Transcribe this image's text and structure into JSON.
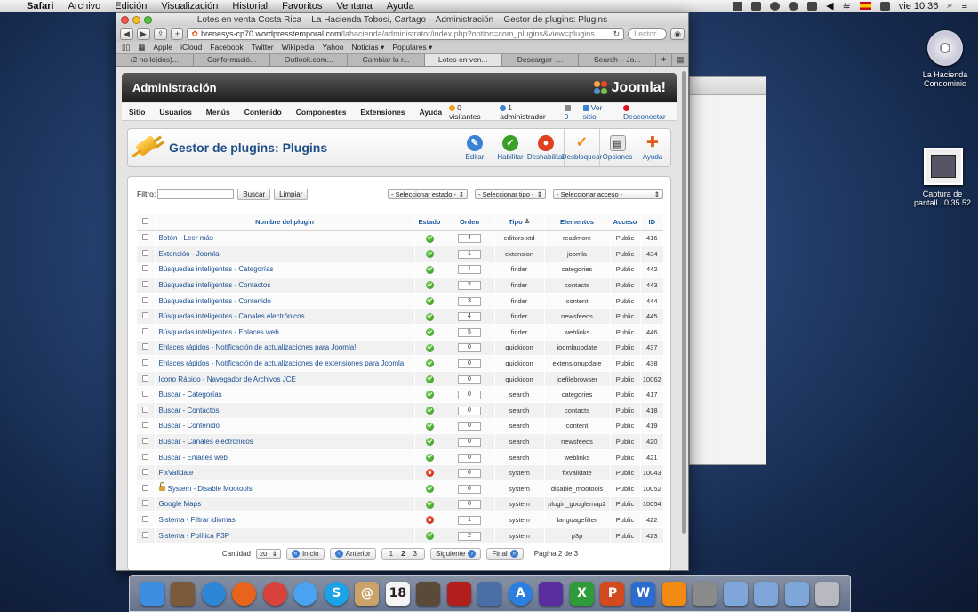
{
  "menubar": {
    "apple": "",
    "items": [
      "Safari",
      "Archivo",
      "Edición",
      "Visualización",
      "Historial",
      "Favoritos",
      "Ventana",
      "Ayuda"
    ],
    "clock": "vie 10:36"
  },
  "desktop": {
    "icons": [
      {
        "label": "La Hacienda Condominio"
      },
      {
        "label": "Captura de pantall...0.35.52"
      }
    ]
  },
  "browser": {
    "title": "Lotes en venta Costa Rica – La Hacienda Tobosi, Cartago – Administración – Gestor de plugins: Plugins",
    "url_main": "brenesys-cp70.wordpresstemporal.com",
    "url_path": "/lahacienda/administrator/index.php?option=com_plugins&view=plugins",
    "search_placeholder": "Lector",
    "bookmarks": [
      "Apple",
      "iCloud",
      "Facebook",
      "Twitter",
      "Wikipedia",
      "Yahoo",
      "Noticias ▾",
      "Populares ▾"
    ],
    "tabs": [
      "(2 no leídos)...",
      "Conformació...",
      "Outlook.com...",
      "Cambiar la r...",
      "Lotes en ven...",
      "Descargar -...",
      "Search – Jo..."
    ],
    "active_tab": 4
  },
  "joomla": {
    "header_title": "Administración",
    "logo_text": "Joomla!",
    "menu": [
      "Sitio",
      "Usuarios",
      "Menús",
      "Contenido",
      "Componentes",
      "Extensiones",
      "Ayuda"
    ],
    "status": {
      "visitors": "0 visitantes",
      "admins": "1 administrador",
      "messages": "0",
      "view_site": "Ver sitio",
      "logout": "Desconectar"
    },
    "page_title": "Gestor de plugins: Plugins",
    "actions": [
      {
        "label": "Editar",
        "icon": "edit-icon",
        "color": "#3a83d4"
      },
      {
        "label": "Habilitar",
        "icon": "enable-icon",
        "color": "#3aa02a"
      },
      {
        "label": "Deshabilitar",
        "icon": "disable-icon",
        "color": "#e04020"
      },
      {
        "label": "Desbloquear",
        "icon": "checkin-icon",
        "color": "#f08a10"
      },
      {
        "label": "Opciones",
        "icon": "options-icon",
        "color": "#8a8a8a"
      },
      {
        "label": "Ayuda",
        "icon": "help-icon",
        "color": "#e05a1a"
      }
    ],
    "filter": {
      "label": "Filtro:",
      "search_btn": "Buscar",
      "clear_btn": "Limpiar",
      "state": "- Seleccionar estado -",
      "type": "- Seleccionar tipo -",
      "access": "- Seleccionar acceso -"
    },
    "columns": [
      "Nombre del plugin",
      "Estado",
      "Orden",
      "Tipo",
      "Elementos",
      "Acceso",
      "ID"
    ],
    "rows": [
      {
        "name": "Botón - Leer más",
        "enabled": true,
        "order": "4",
        "type": "editors-xtd",
        "element": "readmore",
        "access": "Public",
        "id": "416"
      },
      {
        "name": "Extensión - Joomla",
        "enabled": true,
        "order": "1",
        "type": "extension",
        "element": "joomla",
        "access": "Public",
        "id": "434"
      },
      {
        "name": "Búsquedas inteligentes - Categorías",
        "enabled": true,
        "order": "1",
        "type": "finder",
        "element": "categories",
        "access": "Public",
        "id": "442"
      },
      {
        "name": "Búsquedas inteligentes - Contactos",
        "enabled": true,
        "order": "2",
        "type": "finder",
        "element": "contacts",
        "access": "Public",
        "id": "443"
      },
      {
        "name": "Búsquedas inteligentes - Contenido",
        "enabled": true,
        "order": "3",
        "type": "finder",
        "element": "content",
        "access": "Public",
        "id": "444"
      },
      {
        "name": "Búsquedas inteligentes - Canales electrónicos",
        "enabled": true,
        "order": "4",
        "type": "finder",
        "element": "newsfeeds",
        "access": "Public",
        "id": "445"
      },
      {
        "name": "Búsquedas inteligentes - Enlaces web",
        "enabled": true,
        "order": "5",
        "type": "finder",
        "element": "weblinks",
        "access": "Public",
        "id": "446"
      },
      {
        "name": "Enlaces rápidos - Notificación de actualizaciones para Joomla!",
        "enabled": true,
        "order": "0",
        "type": "quickicon",
        "element": "joomlaupdate",
        "access": "Public",
        "id": "437"
      },
      {
        "name": "Enlaces rápidos - Notificación de actualizaciones de extensiones para Joomla!",
        "enabled": true,
        "order": "0",
        "type": "quickicon",
        "element": "extensionupdate",
        "access": "Public",
        "id": "438"
      },
      {
        "name": "Icono Rápido - Navegador de Archivos JCE",
        "enabled": true,
        "order": "0",
        "type": "quickicon",
        "element": "jcefilebrowser",
        "access": "Public",
        "id": "10062"
      },
      {
        "name": "Buscar - Categorías",
        "enabled": true,
        "order": "0",
        "type": "search",
        "element": "categories",
        "access": "Public",
        "id": "417"
      },
      {
        "name": "Buscar - Contactos",
        "enabled": true,
        "order": "0",
        "type": "search",
        "element": "contacts",
        "access": "Public",
        "id": "418"
      },
      {
        "name": "Buscar - Contenido",
        "enabled": true,
        "order": "0",
        "type": "search",
        "element": "content",
        "access": "Public",
        "id": "419"
      },
      {
        "name": "Buscar - Canales electrónicos",
        "enabled": true,
        "order": "0",
        "type": "search",
        "element": "newsfeeds",
        "access": "Public",
        "id": "420"
      },
      {
        "name": "Buscar - Enlaces web",
        "enabled": true,
        "order": "0",
        "type": "search",
        "element": "weblinks",
        "access": "Public",
        "id": "421"
      },
      {
        "name": "FixValidate",
        "enabled": false,
        "order": "0",
        "type": "system",
        "element": "fixvalidate",
        "access": "Public",
        "id": "10043"
      },
      {
        "name": "System - Disable Mootools",
        "enabled": true,
        "order": "0",
        "type": "system",
        "element": "disable_mootools",
        "access": "Public",
        "id": "10052",
        "locked": true
      },
      {
        "name": "Google Maps",
        "enabled": true,
        "order": "0",
        "type": "system",
        "element": "plugin_googlemap2",
        "access": "Public",
        "id": "10054"
      },
      {
        "name": "Sistema - Filtrar idiomas",
        "enabled": false,
        "order": "1",
        "type": "system",
        "element": "languagefilter",
        "access": "Public",
        "id": "422"
      },
      {
        "name": "Sistema - Política P3P",
        "enabled": true,
        "order": "2",
        "type": "system",
        "element": "p3p",
        "access": "Public",
        "id": "423"
      }
    ],
    "pager": {
      "quantity_label": "Cantidad",
      "quantity": "20",
      "first": "Inicio",
      "prev": "Anterior",
      "pages": [
        "1",
        "2",
        "3"
      ],
      "current_page": "2",
      "next": "Siguiente",
      "last": "Final",
      "info": "Página 2 de 3"
    }
  },
  "dock": {
    "apps": [
      {
        "name": "finder",
        "color": "#3d8ee0",
        "glyph": ""
      },
      {
        "name": "preview",
        "color": "#7a5a3a",
        "glyph": ""
      },
      {
        "name": "safari",
        "color": "#2f86d6",
        "glyph": ""
      },
      {
        "name": "firefox",
        "color": "#e8641c",
        "glyph": ""
      },
      {
        "name": "chrome",
        "color": "#d9423a",
        "glyph": ""
      },
      {
        "name": "messages",
        "color": "#4aa2f0",
        "glyph": ""
      },
      {
        "name": "skype",
        "color": "#1aa3e8",
        "glyph": "S"
      },
      {
        "name": "contacts",
        "color": "#c9a36a",
        "glyph": "@"
      },
      {
        "name": "calendar",
        "color": "#f4f4f4",
        "glyph": "18"
      },
      {
        "name": "photos",
        "color": "#5a4a3a",
        "glyph": ""
      },
      {
        "name": "photo-booth",
        "color": "#b21e1e",
        "glyph": ""
      },
      {
        "name": "itunes",
        "color": "#4a6ea8",
        "glyph": ""
      },
      {
        "name": "app-store",
        "color": "#2a7fe0",
        "glyph": "A"
      },
      {
        "name": "imovie",
        "color": "#5b2ea0",
        "glyph": ""
      },
      {
        "name": "excel",
        "color": "#2e9a3a",
        "glyph": "X"
      },
      {
        "name": "powerpoint",
        "color": "#d24a1e",
        "glyph": "P"
      },
      {
        "name": "word",
        "color": "#2b6cd0",
        "glyph": "W"
      },
      {
        "name": "vlc",
        "color": "#f08a10",
        "glyph": ""
      },
      {
        "name": "system-preferences",
        "color": "#8a8a8a",
        "glyph": ""
      },
      {
        "name": "applications-folder",
        "color": "#7ea6d8",
        "glyph": ""
      },
      {
        "name": "documents-folder",
        "color": "#7ea6d8",
        "glyph": ""
      },
      {
        "name": "downloads-folder",
        "color": "#7ea6d8",
        "glyph": ""
      },
      {
        "name": "trash",
        "color": "#b8b8c0",
        "glyph": ""
      }
    ]
  }
}
